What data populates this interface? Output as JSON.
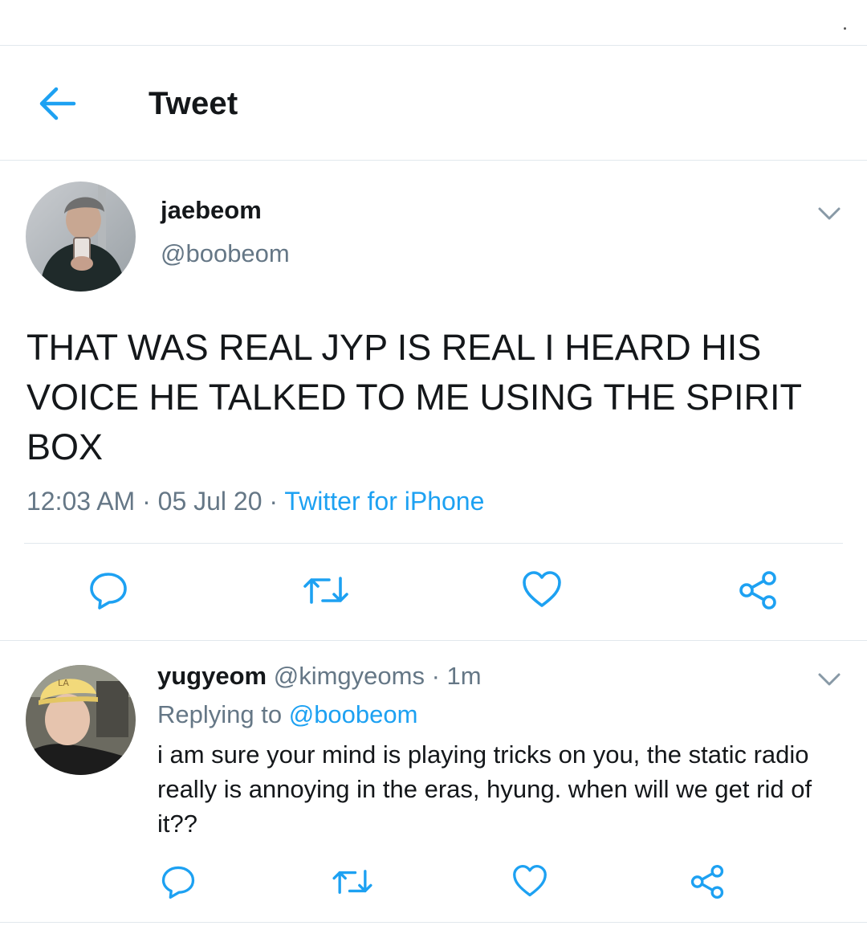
{
  "header": {
    "title": "Tweet",
    "back_icon": "arrow-left-icon"
  },
  "colors": {
    "accent": "#1da1f2",
    "muted": "#657786",
    "text": "#14171a",
    "divider": "#e1e8ed"
  },
  "tweet": {
    "author_name": "jaebeom",
    "author_handle": "@boobeom",
    "text": "THAT WAS REAL JYP IS REAL I HEARD HIS VOICE HE TALKED TO ME USING THE SPIRIT BOX",
    "time": "12:03 AM",
    "date": "05 Jul 20",
    "separator": " · ",
    "source": "Twitter for iPhone",
    "actions": [
      "reply-icon",
      "retweet-icon",
      "like-icon",
      "share-icon"
    ]
  },
  "reply": {
    "author_name": "yugyeom",
    "author_handle": "@kimgyeoms",
    "age": "1m",
    "separator": " · ",
    "replying_prefix": "Replying to ",
    "replying_to": "@boobeom",
    "text": "i am sure your mind is playing tricks on you, the static radio really is annoying in the eras, hyung. when will we get rid of it??",
    "actions": [
      "reply-icon",
      "retweet-icon",
      "like-icon",
      "share-icon"
    ]
  }
}
